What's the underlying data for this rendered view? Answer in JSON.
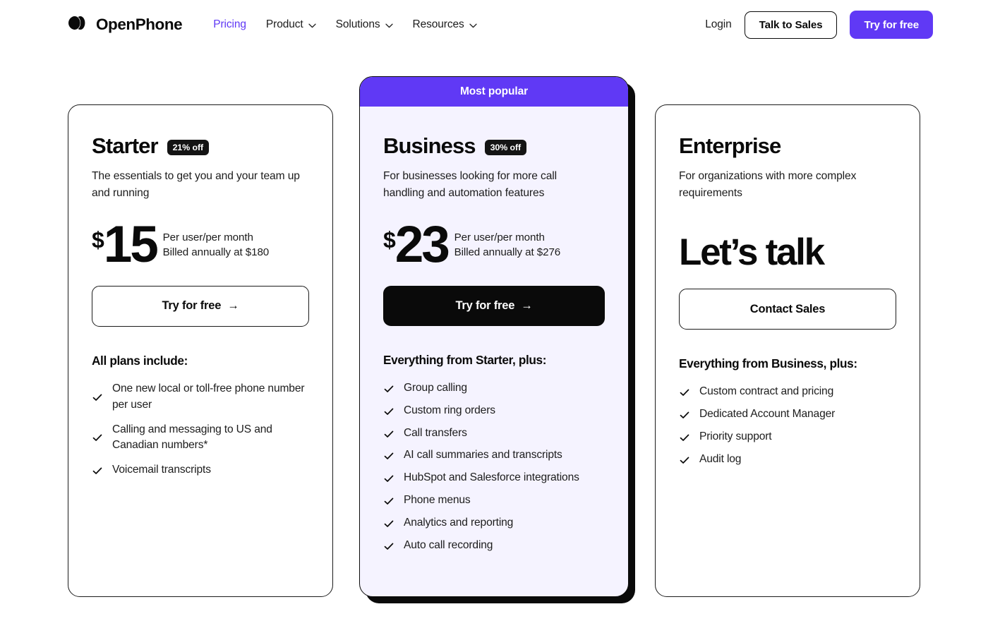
{
  "nav": {
    "brand": "OpenPhone",
    "brand_icon": "openphone-logo-icon",
    "links": [
      {
        "label": "Pricing",
        "has_chevron": false,
        "active": true
      },
      {
        "label": "Product",
        "has_chevron": true,
        "active": false
      },
      {
        "label": "Solutions",
        "has_chevron": true,
        "active": false
      },
      {
        "label": "Resources",
        "has_chevron": true,
        "active": false
      }
    ],
    "login_label": "Login",
    "talk_to_sales_label": "Talk to Sales",
    "try_for_free_label": "Try for free",
    "accent_color": "#6039f5"
  },
  "plans": {
    "starter": {
      "name": "Starter",
      "badge": "21% off",
      "description": "The essentials to get you and your team up and running",
      "currency": "$",
      "amount": "15",
      "per": "Per user/per month",
      "billed": "Billed annually at $180",
      "cta": "Try for free",
      "cta_arrow": "→",
      "features_title": "All plans include:",
      "features": [
        "One new local or toll-free phone number per user",
        "Calling and messaging to US and Canadian numbers*",
        "Voicemail transcripts"
      ]
    },
    "business": {
      "ribbon": "Most popular",
      "name": "Business",
      "badge": "30% off",
      "description": "For businesses looking for more call handling and automation features",
      "currency": "$",
      "amount": "23",
      "per": "Per user/per month",
      "billed": "Billed annually at $276",
      "cta": "Try for free",
      "cta_arrow": "→",
      "features_title": "Everything from Starter, plus:",
      "features": [
        "Group calling",
        "Custom ring orders",
        "Call transfers",
        "AI call summaries and transcripts",
        "HubSpot and Salesforce integrations",
        "Phone menus",
        "Analytics and reporting",
        "Auto call recording"
      ],
      "bg_color": "#f5f3ff",
      "ribbon_color": "#6039f5"
    },
    "enterprise": {
      "name": "Enterprise",
      "description": "For organizations with more complex requirements",
      "headline": "Let’s talk",
      "cta": "Contact Sales",
      "features_title": "Everything from Business, plus:",
      "features": [
        "Custom contract and pricing",
        "Dedicated Account Manager",
        "Priority support",
        "Audit log"
      ]
    }
  }
}
